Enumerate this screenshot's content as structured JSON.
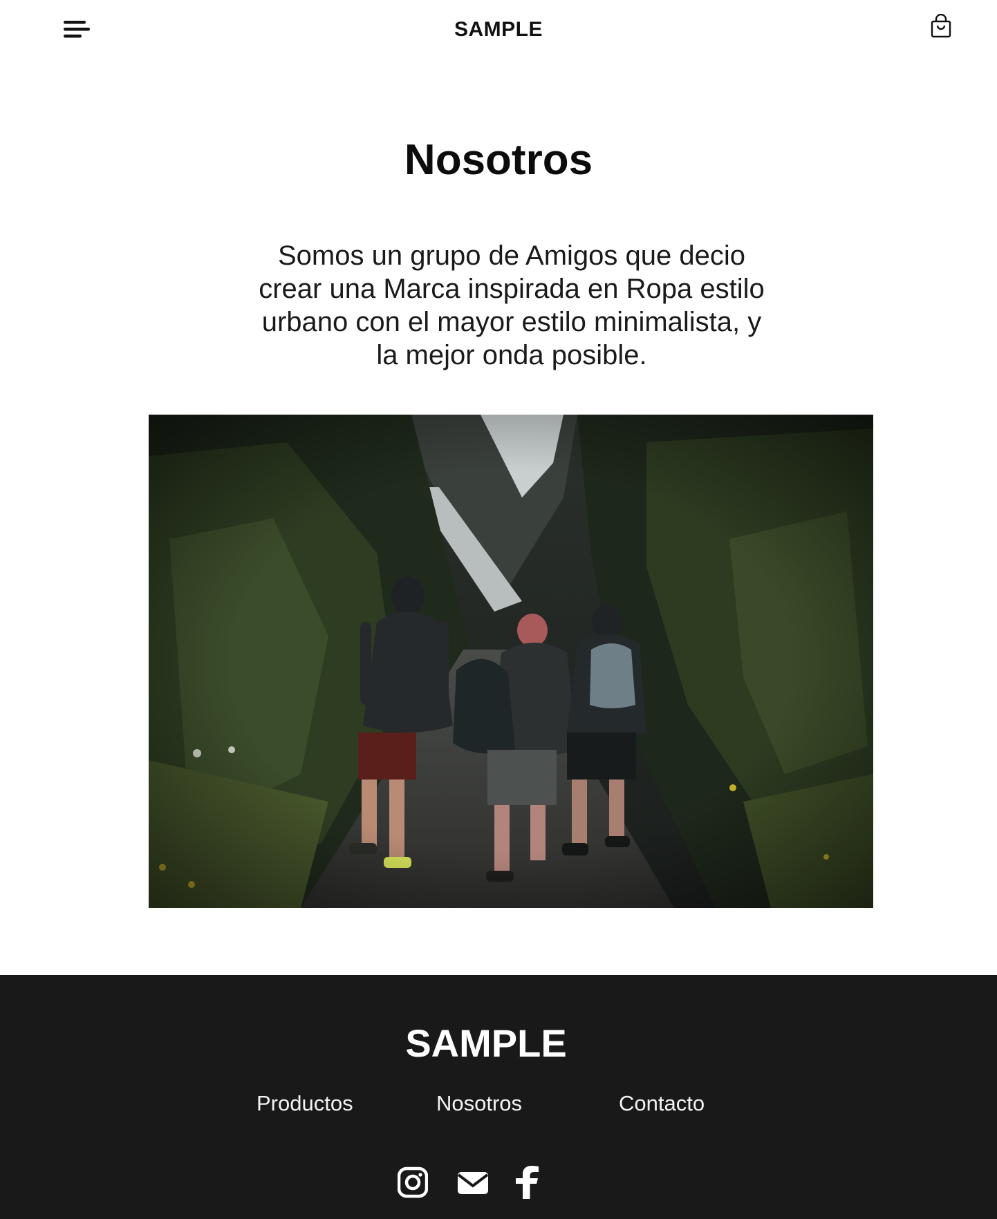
{
  "header": {
    "brand": "SAMPLE",
    "menu_icon": "hamburger-menu-icon",
    "cart_icon": "shopping-bag-icon"
  },
  "main": {
    "title": "Nosotros",
    "intro": "Somos un grupo de Amigos que decio crear una Marca inspirada en Ropa estilo urbano con el mayor estilo minimalista, y la mejor onda posible."
  },
  "footer": {
    "brand": "SAMPLE",
    "nav": [
      {
        "label": "Productos"
      },
      {
        "label": "Nosotros"
      },
      {
        "label": "Contacto"
      }
    ],
    "social": [
      {
        "icon": "instagram-icon"
      },
      {
        "icon": "mail-icon"
      },
      {
        "icon": "facebook-icon"
      }
    ]
  },
  "colors": {
    "text": "#111111",
    "background": "#ffffff",
    "footer_background": "#191919",
    "footer_text": "#ffffff"
  }
}
